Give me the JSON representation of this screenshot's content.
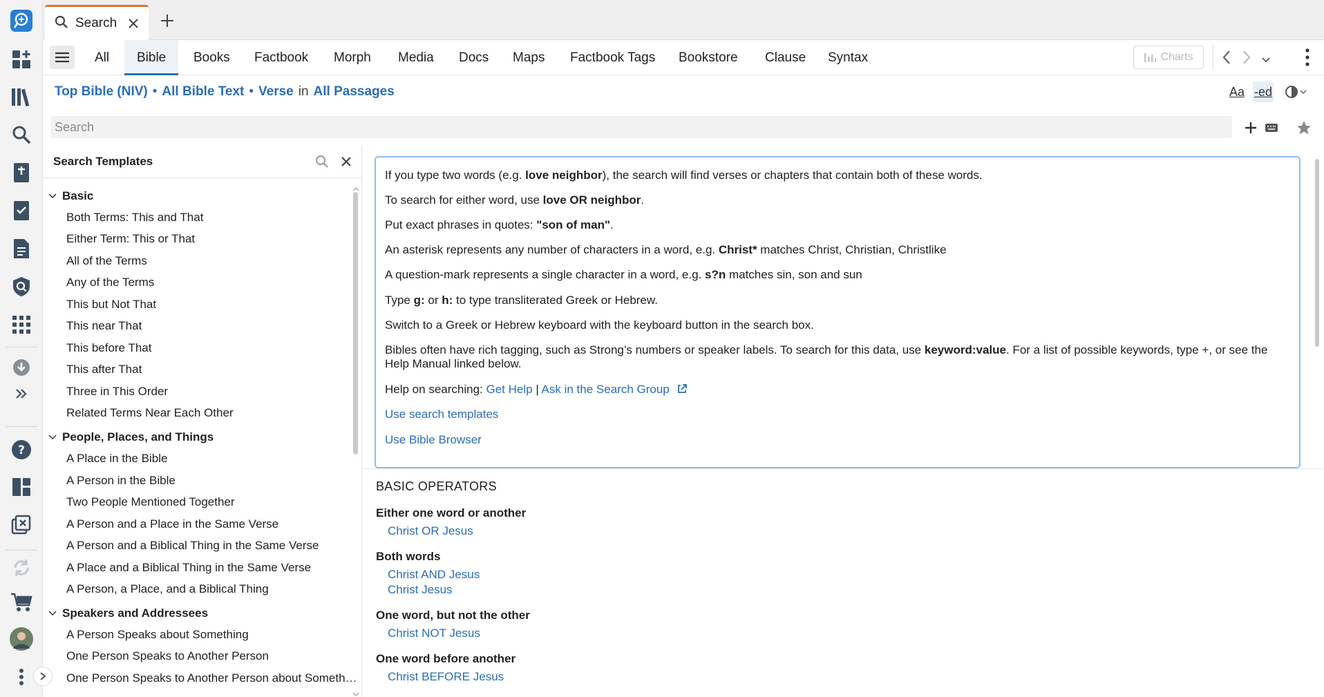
{
  "tab": {
    "label": "Search"
  },
  "nav": {
    "tabs": [
      "All",
      "Bible",
      "Books",
      "Factbook",
      "Morph",
      "Media",
      "Docs",
      "Maps",
      "Factbook Tags",
      "Bookstore",
      "Clause",
      "Syntax"
    ],
    "active": "Bible",
    "charts_label": "Charts"
  },
  "scope": {
    "resource": "Top Bible (NIV)",
    "text": "All Bible Text",
    "unit": "Verse",
    "in_label": "in",
    "range": "All Passages",
    "font_label": "Aa",
    "ed_label": "-ed"
  },
  "search": {
    "placeholder": "Search"
  },
  "templates": {
    "title": "Search Templates",
    "groups": [
      {
        "name": "Basic",
        "items": [
          "Both Terms: This and That",
          "Either Term: This or That",
          "All of the Terms",
          "Any of the Terms",
          "This but Not That",
          "This near That",
          "This before That",
          "This after That",
          "Three in This Order",
          "Related Terms Near Each Other"
        ]
      },
      {
        "name": "People, Places, and Things",
        "items": [
          "A Place in the Bible",
          "A Person in the Bible",
          "Two People Mentioned Together",
          "A Person and a Place in the Same Verse",
          "A Person and a Biblical Thing in the Same Verse",
          "A Place and a Biblical Thing in the Same Verse",
          "A Person, a Place, and a Biblical Thing"
        ]
      },
      {
        "name": "Speakers and Addressees",
        "items": [
          "A Person Speaks about Something",
          "One Person Speaks to Another Person",
          "One Person Speaks to Another Person about Someth…"
        ]
      }
    ]
  },
  "help": {
    "l1a": "If you type two words (e.g. ",
    "l1b": "love neighbor",
    "l1c": "), the search will find verses or chapters that contain both of these words.",
    "l2a": "To search for either word, use ",
    "l2b": "love OR neighbor",
    "l2c": ".",
    "l3a": "Put exact phrases in quotes: ",
    "l3b": "\"son of man\"",
    "l3c": ".",
    "l4a": "An asterisk represents any number of characters in a word, e.g. ",
    "l4b": "Christ*",
    "l4c": " matches Christ, Christian, Christlike",
    "l5a": "A question-mark represents a single character in a word, e.g. ",
    "l5b": "s?n",
    "l5c": " matches sin, son and sun",
    "l6a": "Type ",
    "l6b": "g:",
    "l6c": " or ",
    "l6d": "h:",
    "l6e": " to type transliterated Greek or Hebrew.",
    "l7": "Switch to a Greek or Hebrew keyboard with the keyboard button in the search box.",
    "l8a": "Bibles often have rich tagging, such as Strong’s numbers or speaker labels. To search for this data, use ",
    "l8b": "keyword:value",
    "l8c": ". For a list of possible keywords, type +, or see the Help Manual linked below.",
    "l9a": "Help on searching: ",
    "get_help": "Get Help",
    "sep": "|",
    "ask_group": "Ask in the Search Group",
    "use_templates": "Use search templates",
    "use_browser": "Use Bible Browser"
  },
  "operators": {
    "title": "BASIC OPERATORS",
    "items": [
      {
        "heading": "Either one word or another",
        "examples": [
          "Christ OR Jesus"
        ]
      },
      {
        "heading": "Both words",
        "examples": [
          "Christ AND Jesus",
          "Christ Jesus"
        ]
      },
      {
        "heading": "One word, but not the other",
        "examples": [
          "Christ NOT Jesus"
        ]
      },
      {
        "heading": "One word before another",
        "examples": [
          "Christ BEFORE Jesus"
        ]
      }
    ]
  },
  "colors": {
    "accent": "#2a6eb8",
    "tab_accent": "#e0702c",
    "info_border": "#8ebfe8"
  }
}
